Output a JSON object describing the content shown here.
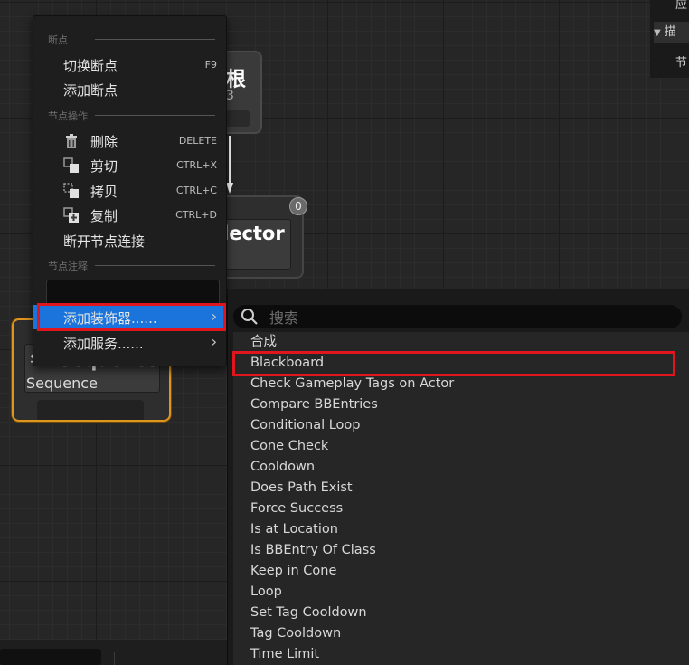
{
  "graph": {
    "root_node": {
      "title": "根",
      "subtitle": "3"
    },
    "selector_node": {
      "title": "lector",
      "subtitle": "r",
      "badge": "0"
    },
    "sequence_node": {
      "title": "Sequence",
      "subtitle": "Sequence"
    }
  },
  "details_panel": {
    "rows": [
      "应",
      "描",
      "节"
    ]
  },
  "context_menu": {
    "section_breakpoints": "断点",
    "toggle_breakpoint": {
      "label": "切换断点",
      "shortcut": "F9"
    },
    "add_breakpoint": {
      "label": "添加断点"
    },
    "section_node_actions": "节点操作",
    "delete": {
      "label": "删除",
      "shortcut": "DELETE"
    },
    "cut": {
      "label": "剪切",
      "shortcut": "CTRL+X"
    },
    "copy": {
      "label": "拷贝",
      "shortcut": "CTRL+C"
    },
    "duplicate": {
      "label": "复制",
      "shortcut": "CTRL+D"
    },
    "break_links": {
      "label": "断开节点连接"
    },
    "section_node_comment": "节点注释",
    "comment_value": "",
    "add_decorator": {
      "label": "添加装饰器......"
    },
    "add_service": {
      "label": "添加服务......"
    }
  },
  "submenu": {
    "search_placeholder": "搜索",
    "items": [
      "合成",
      "Blackboard",
      "Check Gameplay Tags on Actor",
      "Compare BBEntries",
      "Conditional Loop",
      "Cone Check",
      "Cooldown",
      "Does Path Exist",
      "Force Success",
      "Is at Location",
      "Is BBEntry Of Class",
      "Keep in Cone",
      "Loop",
      "Set Tag Cooldown",
      "Tag Cooldown",
      "Time Limit"
    ]
  },
  "colors": {
    "highlight": "#1a74db",
    "annotation_red": "#e0161e",
    "selected_node_border": "#e0961c"
  }
}
